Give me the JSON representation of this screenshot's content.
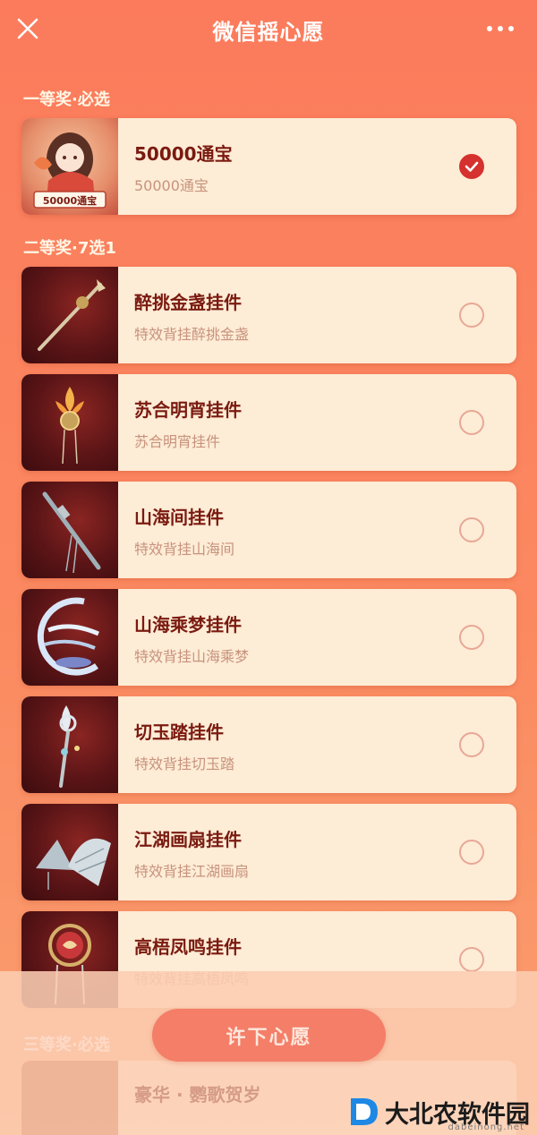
{
  "header": {
    "title": "微信摇心愿",
    "close_icon": "close-icon",
    "more_icon": "more-horizontal-icon"
  },
  "sections": [
    {
      "title": "一等奖·必选"
    },
    {
      "title": "二等奖·7选1"
    },
    {
      "title": "三等奖·必选"
    }
  ],
  "prizes": [
    {
      "name": "50000通宝",
      "desc": "50000通宝",
      "selected": true,
      "thumb_caption": "50000通宝"
    },
    {
      "name": "醉挑金盏挂件",
      "desc": "特效背挂醉挑金盏",
      "selected": false
    },
    {
      "name": "苏合明宵挂件",
      "desc": "苏合明宵挂件",
      "selected": false
    },
    {
      "name": "山海间挂件",
      "desc": "特效背挂山海间",
      "selected": false
    },
    {
      "name": "山海乘梦挂件",
      "desc": "特效背挂山海乘梦",
      "selected": false
    },
    {
      "name": "切玉踏挂件",
      "desc": "特效背挂切玉踏",
      "selected": false
    },
    {
      "name": "江湖画扇挂件",
      "desc": "特效背挂江湖画扇",
      "selected": false
    },
    {
      "name": "高梧凤鸣挂件",
      "desc": "特效背挂高梧凤鸣",
      "selected": false
    }
  ],
  "third_prize_partial": {
    "name": "豪华 · 鹦歌贺岁"
  },
  "footer": {
    "wish_button": "许下心愿"
  },
  "watermark": {
    "text": "大北农软件园",
    "sub": "dabeinong.net"
  },
  "colors": {
    "selected": "#d5312e",
    "accent": "#fb7b5c",
    "card_bg": "#fdecd6"
  }
}
